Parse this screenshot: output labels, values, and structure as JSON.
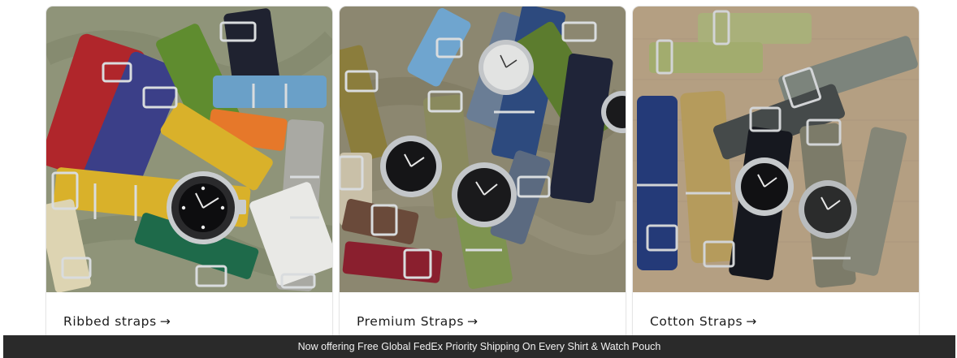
{
  "collections": [
    {
      "label": "Ribbed straps",
      "arrow": "→",
      "image_alt": "pile of colorful ribbed NATO watch straps with a diver watch on green fabric"
    },
    {
      "label": "Premium Straps",
      "arrow": "→",
      "image_alt": "premium nylon watch straps with steel diver watches on olive fabric"
    },
    {
      "label": "Cotton Straps",
      "arrow": "→",
      "image_alt": "cotton watch straps in navy, khaki, olive and grey on a linen background"
    }
  ],
  "announcement_bar": {
    "text": "Now offering Free Global FedEx Priority Shipping On Every Shirt & Watch Pouch"
  },
  "colors": {
    "announcement_bg": "#2a2a2a",
    "announcement_text": "#f2f2f2",
    "card_label": "#1c1c1c",
    "photo_bg_1": "#8f9479",
    "photo_bg_2": "#8c8770",
    "photo_bg_3": "#b49f82"
  }
}
